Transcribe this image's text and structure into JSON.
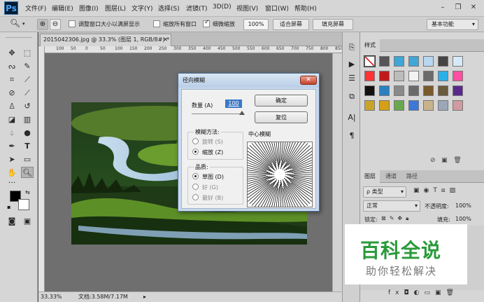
{
  "menu": {
    "logo": "Ps",
    "items": [
      "文件(F)",
      "编辑(E)",
      "图像(I)",
      "图层(L)",
      "文字(Y)",
      "选择(S)",
      "滤镜(T)",
      "3D(D)",
      "视图(V)",
      "窗口(W)",
      "帮助(H)"
    ]
  },
  "options": {
    "resize_windows": "调整窗口大小以满屏显示",
    "zoom_all": "缩放所有窗口",
    "scrubby_zoom": "细微缩放",
    "zoom_value": "100%",
    "fit_screen": "适合屏幕",
    "fill_screen": "填充屏幕",
    "workspace": "基本功能"
  },
  "document": {
    "tab_title": "2015042306.jpg @ 33.3% (图层 1, RGB/8#) *",
    "zoom": "33.33%",
    "doc_info": "文档:3.58M/7.17M",
    "ruler_ticks": [
      "100",
      "50",
      "0",
      "50",
      "100",
      "150",
      "200",
      "250",
      "300",
      "350",
      "400",
      "450",
      "500",
      "550",
      "600",
      "650",
      "700",
      "750",
      "800",
      "850"
    ]
  },
  "styles_panel": {
    "tab": "样式",
    "swatch_colors": [
      "#ffffff",
      "#555555",
      "#3fa7d6",
      "#3fa7d6",
      "#b7d8f0",
      "#444444",
      "#d6e9f8",
      "#ff3333",
      "#c01b1b",
      "#bcbcbc",
      "#f2f2f2",
      "#6b6b6b",
      "#2ab0e8",
      "#ff4fa0",
      "#111111",
      "#2b7fbf",
      "#8a8a8a",
      "#6a6a6a",
      "#7a5a2a",
      "#6b5a3c",
      "#5a2a8a",
      "#caa42a",
      "#d4a017",
      "#6aa84f",
      "#3c78d8",
      "#c9b38a",
      "#9ca6b8",
      "#d09aa0"
    ]
  },
  "layers_panel": {
    "tabs": [
      "图层",
      "通道",
      "路径"
    ],
    "kind_filter": "ρ 类型",
    "blend_mode": "正常",
    "opacity_label": "不透明度:",
    "opacity_value": "100%",
    "lock_label": "锁定:",
    "fill_label": "填充:",
    "fill_value": "100%"
  },
  "dialog": {
    "title": "径向模糊",
    "amount_label": "数量 (A)",
    "amount_value": "100",
    "ok": "确定",
    "reset": "复位",
    "method_title": "模糊方法:",
    "method_options": [
      "旋转 (S)",
      "缩放 (Z)"
    ],
    "method_selected": 1,
    "center_label": "中心模糊",
    "quality_title": "品质:",
    "quality_options": [
      "草图 (D)",
      "好 (G)",
      "最好 (B)"
    ],
    "quality_selected": 0
  },
  "watermark": {
    "title": "百科全说",
    "subtitle": "助你轻松解决"
  }
}
